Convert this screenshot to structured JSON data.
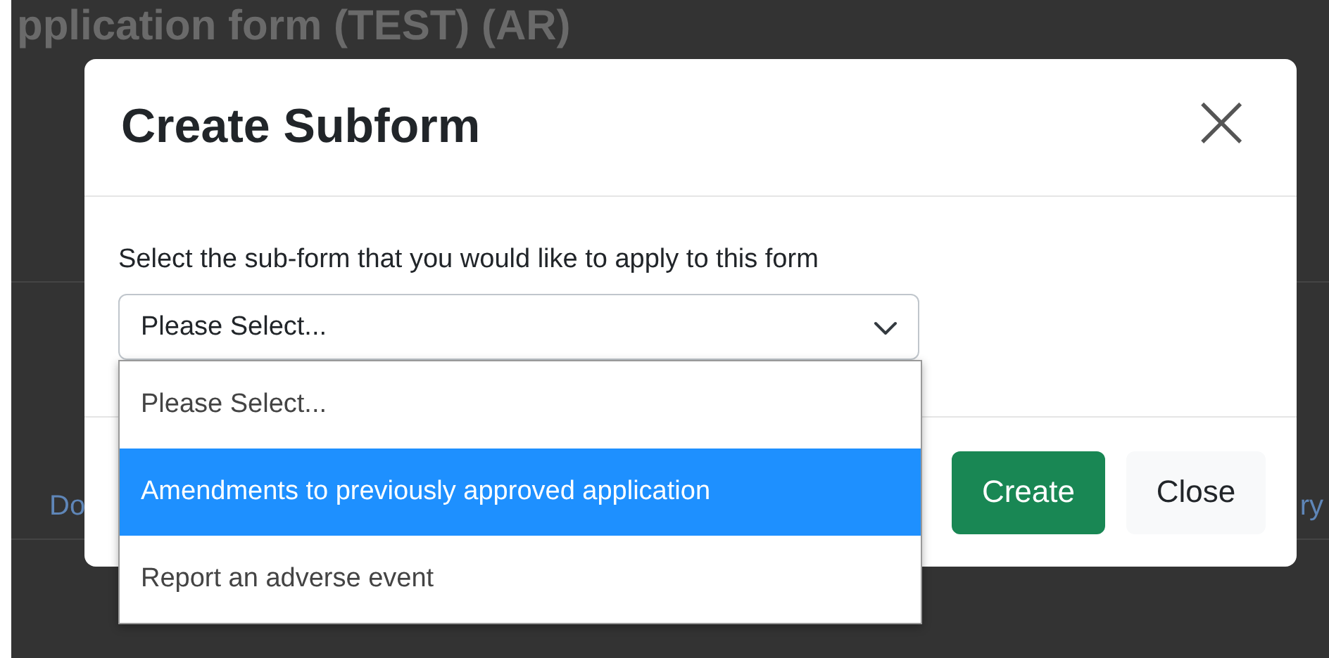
{
  "page": {
    "title": "pplication form (TEST) (AR)",
    "left_tab": "Do",
    "right_tab": "ry"
  },
  "modal": {
    "title": "Create Subform",
    "close_icon": "×",
    "label": "Select the sub-form that you would like to apply to this form",
    "select": {
      "value": "Please Select...",
      "expanded": true
    },
    "options": [
      {
        "label": "Please Select...",
        "selected": false
      },
      {
        "label": "Amendments to previously approved application",
        "selected": true
      },
      {
        "label": "Report an adverse event",
        "selected": false
      }
    ],
    "buttons": [
      {
        "label": "Create",
        "kind": "primary"
      },
      {
        "label": "Close",
        "kind": "secondary"
      }
    ]
  }
}
